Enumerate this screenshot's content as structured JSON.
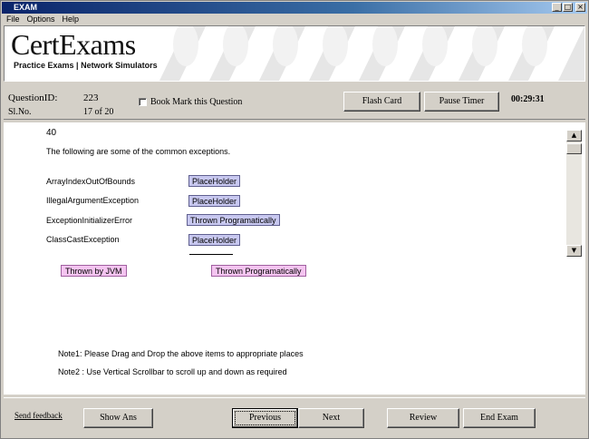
{
  "window": {
    "title": "EXAM"
  },
  "menu": {
    "file": "File",
    "options": "Options",
    "help": "Help"
  },
  "banner": {
    "logo": "CertExams",
    "tagline": "Practice Exams | Network Simulators"
  },
  "info": {
    "question_id_label": "QuestionID:",
    "question_id_value": "223",
    "slno_label": "Sl.No.",
    "slno_value": "17 of 20",
    "bookmark_label": "Book Mark this Question",
    "flash_card": "Flash Card",
    "pause_timer": "Pause Timer",
    "timer": "00:29:31"
  },
  "question": {
    "number": "40",
    "prompt": "The following are some of the common exceptions.",
    "rows": [
      {
        "label": "ArrayIndexOutOfBounds",
        "slot": "PlaceHolder"
      },
      {
        "label": "IllegalArgumentException",
        "slot": "PlaceHolder"
      },
      {
        "label": "ExceptionInitializerError",
        "slot": "Thrown Programatically"
      },
      {
        "label": "ClassCastException",
        "slot": "PlaceHolder"
      }
    ],
    "drag_items": [
      "Thrown by JVM",
      "Thrown Programatically"
    ],
    "note1": "Note1: Please Drag and Drop the above items to appropriate places",
    "note2": "Note2 : Use Vertical Scrollbar to scroll up and down  as required"
  },
  "footer": {
    "feedback": "Send feedback",
    "show_ans": "Show Ans",
    "previous": "Previous",
    "next": "Next",
    "review": "Review",
    "end_exam": "End Exam"
  }
}
